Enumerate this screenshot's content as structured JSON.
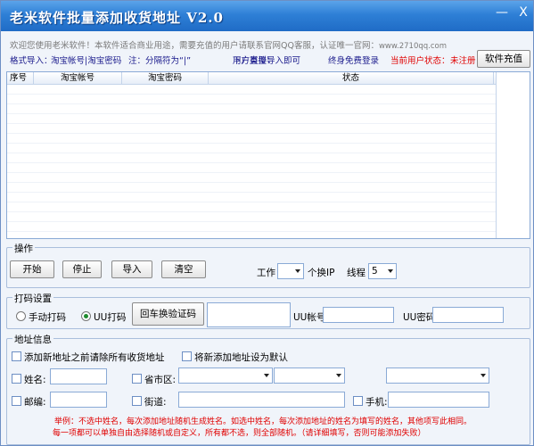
{
  "window": {
    "title": "老米软件批量添加收货地址 V2.0",
    "minimize_glyph": "—",
    "close_glyph": "X"
  },
  "welcome": {
    "text": "欢迎您使用老米软件！本软件适合商业用途，需要充值的用户请联系官网QQ客服，认证唯一官网：",
    "site": "www.2710qq.com"
  },
  "format": {
    "label": "格式导入：",
    "value": "淘宝帐号|淘宝密码",
    "note": "注：分隔符为“|”",
    "import_hint": "下方直接导入即可",
    "user_type_label": "用户类型：",
    "user_type_value": "终身免费登录",
    "status_label": "当前用户状态：",
    "status_value": "未注册"
  },
  "buttons": {
    "recharge": "软件充值",
    "start": "开始",
    "stop": "停止",
    "import": "导入",
    "clear": "清空",
    "change_captcha": "回车换验证码"
  },
  "table": {
    "columns": [
      "序号",
      "淘宝帐号",
      "淘宝密码",
      "状态"
    ],
    "rows": []
  },
  "ops": {
    "title": "操作",
    "work_label": "工作",
    "work_value": "",
    "ip_label": "个换IP",
    "threads_label": "线程",
    "threads_value": "5"
  },
  "captcha": {
    "title": "打码设置",
    "manual_label": "手动打码",
    "uu_label": "UU打码",
    "uu_account_label": "UU帐号",
    "uu_password_label": "UU密码",
    "captcha_value": "",
    "uu_account_value": "",
    "uu_password_value": ""
  },
  "address": {
    "title": "地址信息",
    "clear_before_add": "添加新地址之前请除所有收货地址",
    "set_default": "将新添加地址设为默认",
    "name_label": "姓名:",
    "province_label": "省市区:",
    "postcode_label": "邮编:",
    "street_label": "街道:",
    "phone_label": "手机:",
    "name_value": "",
    "postcode_value": "",
    "street_value": "",
    "phone_value": "",
    "province_value": "",
    "city_value": "",
    "district_value": ""
  },
  "examples": {
    "line1": "举例：不选中姓名，每次添加地址随机生成姓名。如选中姓名，每次添加地址的姓名为填写的姓名，其他项写此相同。",
    "line2": "每一项都可以单独自由选择随机或自定义，所有都不选，则全部随机。（请详细填写，否则可能添加失败）"
  }
}
